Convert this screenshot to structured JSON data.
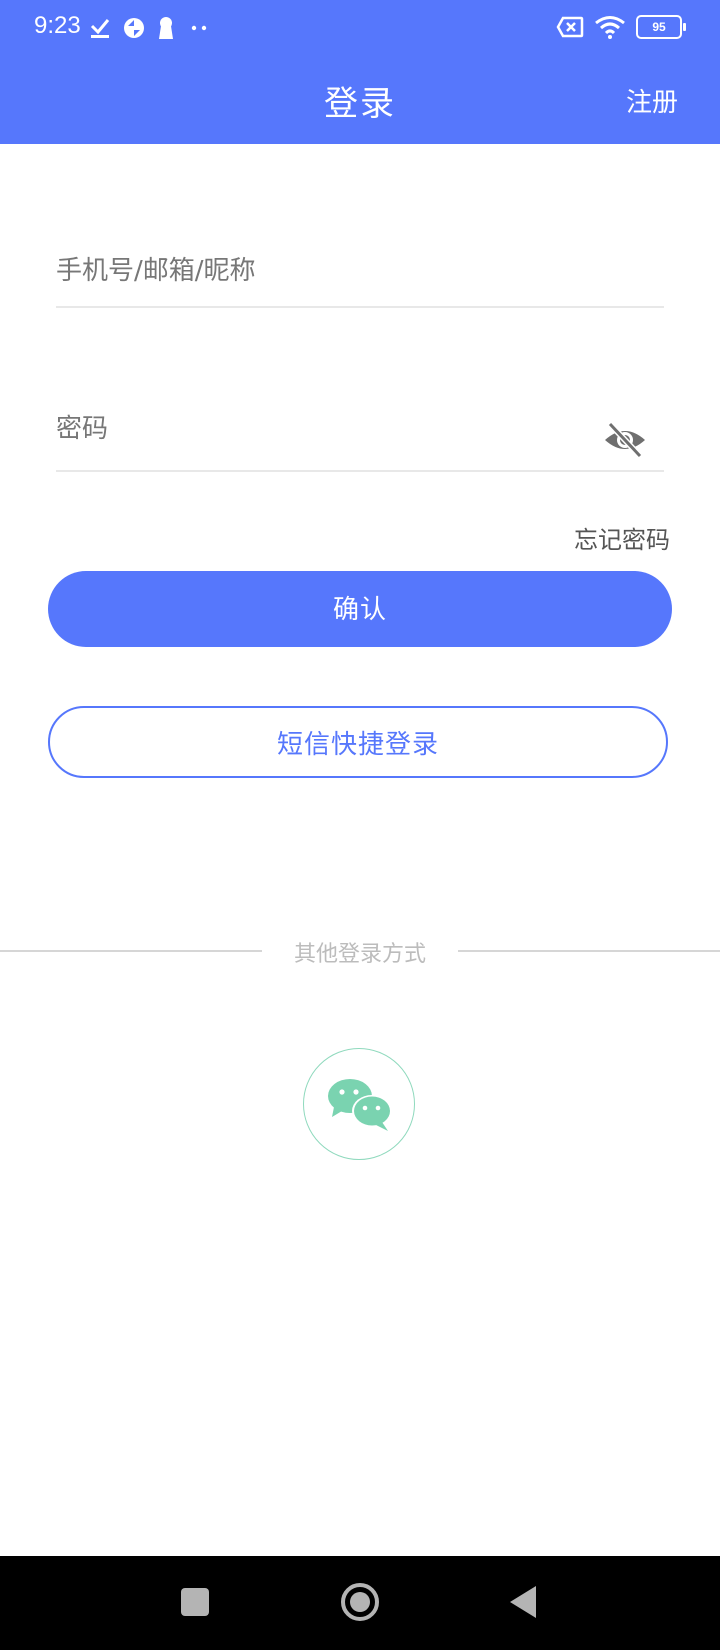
{
  "status_bar": {
    "time": "9:23",
    "battery": "95",
    "icons": [
      "check-icon",
      "sync-icon",
      "keyhole-icon",
      "more-dots-icon",
      "sim-x-icon",
      "wifi-icon",
      "battery-icon"
    ]
  },
  "header": {
    "title": "登录",
    "register_label": "注册"
  },
  "form": {
    "account_placeholder": "手机号/邮箱/昵称",
    "account_value": "",
    "password_placeholder": "密码",
    "password_value": "",
    "password_visibility_icon": "eye-off-icon",
    "forgot_label": "忘记密码",
    "confirm_label": "确认",
    "sms_login_label": "短信快捷登录"
  },
  "other_login": {
    "label": "其他登录方式",
    "providers": [
      "wechat-icon"
    ]
  },
  "colors": {
    "primary": "#5677fc",
    "wechat": "#7ad3b0",
    "divider_text": "#bcbcbc"
  }
}
